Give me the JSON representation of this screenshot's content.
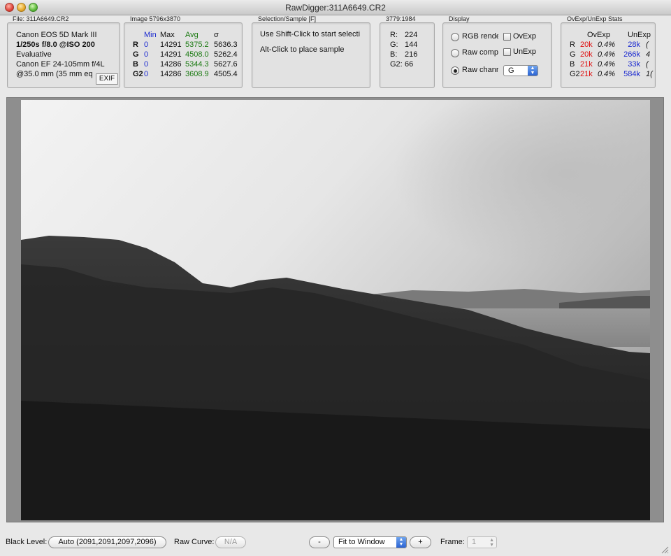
{
  "window": {
    "title": "RawDigger:311A6649.CR2"
  },
  "file_panel": {
    "title": "File: 311A6649.CR2",
    "camera": "Canon EOS 5D Mark III",
    "exposure": "1/250s f/8.0 @ISO 200",
    "metering": "Evaluative",
    "lens": "Canon EF 24-105mm f/4L",
    "focal": "@35.0 mm (35 mm eq",
    "exif_button": "EXIF"
  },
  "image_panel": {
    "title": "Image 5796x3870",
    "headers": {
      "min": "Min",
      "max": "Max",
      "avg": "Avg",
      "sigma": "σ"
    },
    "rows": [
      {
        "channel": "R",
        "min": "0",
        "max": "14291",
        "avg": "5375.2",
        "sigma": "5636.3"
      },
      {
        "channel": "G",
        "min": "0",
        "max": "14291",
        "avg": "4508.0",
        "sigma": "5262.4"
      },
      {
        "channel": "B",
        "min": "0",
        "max": "14286",
        "avg": "5344.3",
        "sigma": "5627.6"
      },
      {
        "channel": "G2",
        "min": "0",
        "max": "14286",
        "avg": "3608.9",
        "sigma": "4505.4"
      }
    ]
  },
  "selection_panel": {
    "title": "Selection/Sample [F]",
    "line1": "Use Shift-Click to start selecti",
    "line2": "Alt-Click to place sample"
  },
  "coords_panel": {
    "title": "3779:1984",
    "rows": [
      {
        "label": "R:",
        "value": "224"
      },
      {
        "label": "G:",
        "value": "144"
      },
      {
        "label": "B:",
        "value": "216"
      },
      {
        "label": "G2:",
        "value": "66"
      }
    ]
  },
  "display_panel": {
    "title": "Display",
    "options": [
      {
        "label": "RGB rende",
        "selected": false
      },
      {
        "label": "Raw comp",
        "selected": false
      },
      {
        "label": "Raw chanr",
        "selected": true
      }
    ],
    "checks": [
      {
        "label": "OvExp",
        "checked": false
      },
      {
        "label": "UnExp",
        "checked": false
      }
    ],
    "channel_select": "G"
  },
  "stats_panel": {
    "title": "OvExp/UnExp Stats",
    "headers": {
      "ovexp": "OvExp",
      "unexp": "UnExp"
    },
    "rows": [
      {
        "channel": "R",
        "ov": "20k",
        "ov_pct": "0.4%",
        "un": "28k",
        "un_pct": "("
      },
      {
        "channel": "G",
        "ov": "20k",
        "ov_pct": "0.4%",
        "un": "266k",
        "un_pct": "4"
      },
      {
        "channel": "B",
        "ov": "21k",
        "ov_pct": "0.4%",
        "un": "33k",
        "un_pct": "("
      },
      {
        "channel": "G2",
        "ov": "21k",
        "ov_pct": "0.4%",
        "un": "584k",
        "un_pct": "1("
      }
    ]
  },
  "bottom_bar": {
    "black_level_label": "Black Level:",
    "black_level_value": "Auto (2091,2091,2097,2096)",
    "raw_curve_label": "Raw Curve:",
    "raw_curve_value": "N/A",
    "zoom_out": "-",
    "zoom_mode": "Fit to Window",
    "zoom_in": "+",
    "frame_label": "Frame:",
    "frame_value": "1"
  },
  "colors": {
    "min_header": "#1c2bd0",
    "avg_values": "#1b7a12",
    "ovexp_values": "#e01010",
    "unexp_values": "#1c2bd0"
  }
}
